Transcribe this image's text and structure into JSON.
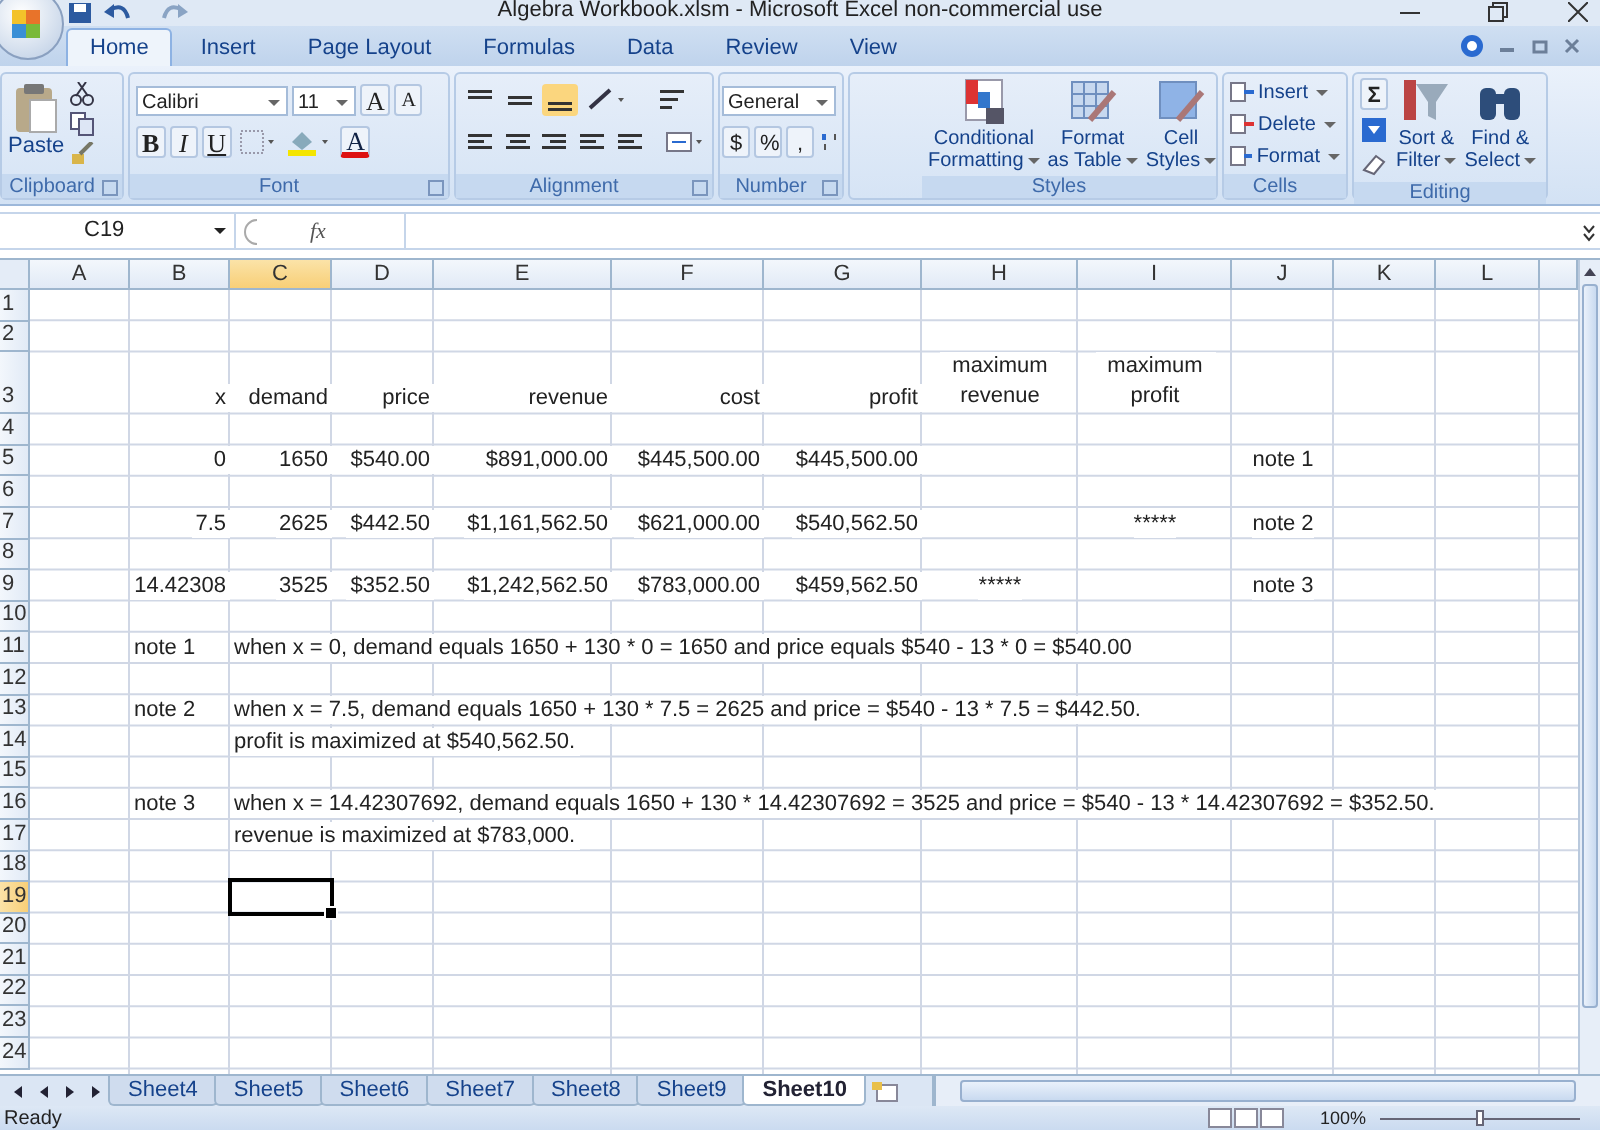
{
  "window": {
    "title": "Algebra Workbook.xlsm - Microsoft Excel non-commercial use"
  },
  "tabs": [
    {
      "label": "Home",
      "selected": true
    },
    {
      "label": "Insert",
      "selected": false
    },
    {
      "label": "Page Layout",
      "selected": false
    },
    {
      "label": "Formulas",
      "selected": false
    },
    {
      "label": "Data",
      "selected": false
    },
    {
      "label": "Review",
      "selected": false
    },
    {
      "label": "View",
      "selected": false
    }
  ],
  "ribbon": {
    "clipboard": {
      "label": "Clipboard",
      "paste": "Paste"
    },
    "font": {
      "label": "Font",
      "family": "Calibri",
      "size": "11",
      "grow": "A",
      "shrink": "A",
      "bold": "B",
      "italic": "I",
      "underline": "U",
      "font_color": "A"
    },
    "alignment": {
      "label": "Alignment"
    },
    "number": {
      "label": "Number",
      "format": "General",
      "currency": "$",
      "percent": "%",
      "comma": ","
    },
    "styles": {
      "label": "Styles",
      "buttons": [
        [
          "Conditional",
          "Formatting"
        ],
        [
          "Format",
          "as Table"
        ],
        [
          "Cell",
          "Styles"
        ]
      ]
    },
    "cells": {
      "label": "Cells",
      "buttons": [
        "Insert",
        "Delete",
        "Format"
      ]
    },
    "editing": {
      "label": "Editing",
      "sum": "Σ",
      "buttons": [
        [
          "Sort &",
          "Filter"
        ],
        [
          "Find &",
          "Select"
        ]
      ]
    }
  },
  "formula_bar": {
    "name_box": "C19",
    "fx": "fx"
  },
  "columns": [
    {
      "label": "A",
      "selected": false
    },
    {
      "label": "B",
      "selected": false
    },
    {
      "label": "C",
      "selected": true
    },
    {
      "label": "D",
      "selected": false
    },
    {
      "label": "E",
      "selected": false
    },
    {
      "label": "F",
      "selected": false
    },
    {
      "label": "G",
      "selected": false
    },
    {
      "label": "H",
      "selected": false
    },
    {
      "label": "I",
      "selected": false
    },
    {
      "label": "J",
      "selected": false
    },
    {
      "label": "K",
      "selected": false
    },
    {
      "label": "L",
      "selected": false
    }
  ],
  "rows": [
    {
      "label": "1",
      "selected": false,
      "tall": false
    },
    {
      "label": "2",
      "selected": false,
      "tall": false
    },
    {
      "label": "3",
      "selected": false,
      "tall": true,
      "cells": [
        {},
        {
          "text": "x",
          "kind": "right"
        },
        {
          "text": "demand",
          "kind": "right"
        },
        {
          "text": "price",
          "kind": "right"
        },
        {
          "text": "revenue",
          "kind": "right"
        },
        {
          "text": "cost",
          "kind": "right"
        },
        {
          "text": "profit",
          "kind": "right"
        },
        {
          "text": "maximum revenue",
          "kind": "wrap"
        },
        {
          "text": "maximum profit",
          "kind": "wrap"
        }
      ]
    },
    {
      "label": "4",
      "selected": false,
      "tall": false
    },
    {
      "label": "5",
      "selected": false,
      "tall": false,
      "cells": [
        {},
        {
          "text": "0",
          "kind": "right"
        },
        {
          "text": "1650",
          "kind": "right"
        },
        {
          "text": "$540.00",
          "kind": "right"
        },
        {
          "text": "$891,000.00",
          "kind": "right"
        },
        {
          "text": "$445,500.00",
          "kind": "right"
        },
        {
          "text": "$445,500.00",
          "kind": "right"
        },
        {},
        {},
        {
          "text": "note 1",
          "kind": "center"
        }
      ]
    },
    {
      "label": "6",
      "selected": false,
      "tall": false
    },
    {
      "label": "7",
      "selected": false,
      "tall": false,
      "cells": [
        {},
        {
          "text": "7.5",
          "kind": "right"
        },
        {
          "text": "2625",
          "kind": "right"
        },
        {
          "text": "$442.50",
          "kind": "right"
        },
        {
          "text": "$1,161,562.50",
          "kind": "right"
        },
        {
          "text": "$621,000.00",
          "kind": "right"
        },
        {
          "text": "$540,562.50",
          "kind": "right"
        },
        {},
        {
          "text": "*****",
          "kind": "center"
        },
        {
          "text": "note 2",
          "kind": "center"
        }
      ]
    },
    {
      "label": "8",
      "selected": false,
      "tall": false
    },
    {
      "label": "9",
      "selected": false,
      "tall": false,
      "cells": [
        {},
        {
          "text": "14.42308",
          "kind": "right"
        },
        {
          "text": "3525",
          "kind": "right"
        },
        {
          "text": "$352.50",
          "kind": "right"
        },
        {
          "text": "$1,242,562.50",
          "kind": "right"
        },
        {
          "text": "$783,000.00",
          "kind": "right"
        },
        {
          "text": "$459,562.50",
          "kind": "right"
        },
        {
          "text": "*****",
          "kind": "center"
        },
        {},
        {
          "text": "note 3",
          "kind": "center"
        }
      ]
    },
    {
      "label": "10",
      "selected": false,
      "tall": false
    },
    {
      "label": "11",
      "selected": false,
      "tall": false,
      "cells": [
        {},
        {
          "text": "note 1",
          "kind": "left"
        },
        {
          "text": "when x = 0, demand equals 1650 + 130 * 0 = 1650 and price equals $540 - 13 * 0 = $540.00",
          "kind": "left"
        }
      ]
    },
    {
      "label": "12",
      "selected": false,
      "tall": false
    },
    {
      "label": "13",
      "selected": false,
      "tall": false,
      "cells": [
        {},
        {
          "text": "note 2",
          "kind": "left"
        },
        {
          "text": "when x = 7.5, demand equals 1650 + 130 * 7.5 = 2625 and price = $540 - 13 * 7.5 = $442.50.",
          "kind": "left"
        }
      ]
    },
    {
      "label": "14",
      "selected": false,
      "tall": false,
      "cells": [
        {},
        {},
        {
          "text": "profit is maximized at $540,562.50.",
          "kind": "left"
        }
      ]
    },
    {
      "label": "15",
      "selected": false,
      "tall": false
    },
    {
      "label": "16",
      "selected": false,
      "tall": false,
      "cells": [
        {},
        {
          "text": "note 3",
          "kind": "left"
        },
        {
          "text": "when x = 14.42307692, demand equals 1650 + 130 * 14.42307692  = 3525 and price = $540 - 13 * 14.42307692 = $352.50.",
          "kind": "left"
        }
      ]
    },
    {
      "label": "17",
      "selected": false,
      "tall": false,
      "cells": [
        {},
        {},
        {
          "text": "revenue is maximized at $783,000.",
          "kind": "left"
        }
      ]
    },
    {
      "label": "18",
      "selected": false,
      "tall": false
    },
    {
      "label": "19",
      "selected": true,
      "tall": false
    },
    {
      "label": "20",
      "selected": false,
      "tall": false
    },
    {
      "label": "21",
      "selected": false,
      "tall": false
    },
    {
      "label": "22",
      "selected": false,
      "tall": false
    },
    {
      "label": "23",
      "selected": false,
      "tall": false
    },
    {
      "label": "24",
      "selected": false,
      "tall": false
    }
  ],
  "sheet_tabs": [
    {
      "label": "Sheet4",
      "selected": false
    },
    {
      "label": "Sheet5",
      "selected": false
    },
    {
      "label": "Sheet6",
      "selected": false
    },
    {
      "label": "Sheet7",
      "selected": false
    },
    {
      "label": "Sheet8",
      "selected": false
    },
    {
      "label": "Sheet9",
      "selected": false
    },
    {
      "label": "Sheet10",
      "selected": true
    }
  ],
  "status_bar": {
    "text": "Ready",
    "zoom": "100%",
    "zoom_slider": {
      "level": 0.5
    }
  }
}
